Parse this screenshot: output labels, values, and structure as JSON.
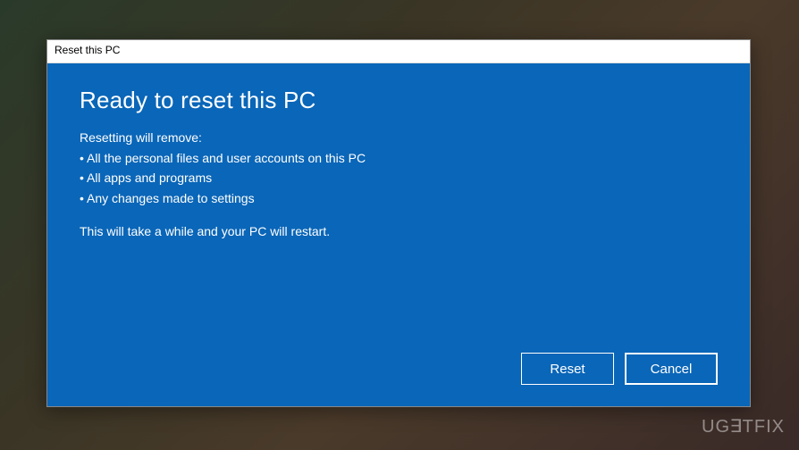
{
  "dialog": {
    "title": "Reset this PC",
    "heading": "Ready to reset this PC",
    "subheading": "Resetting will remove:",
    "bullets": [
      "All the personal files and user accounts on this PC",
      "All apps and programs",
      "Any changes made to settings"
    ],
    "note": "This will take a while and your PC will restart.",
    "buttons": {
      "primary": "Reset",
      "secondary": "Cancel"
    }
  },
  "watermark": "UGETFIX"
}
